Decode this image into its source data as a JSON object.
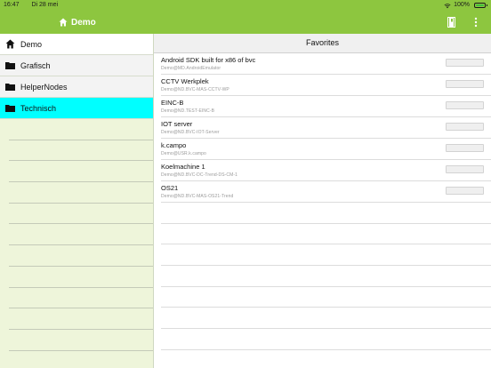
{
  "status_bar": {
    "time": "16:47",
    "date": "Di 28 mei",
    "battery": "100%",
    "battery_level": 1.0
  },
  "nav_bar": {
    "title": "Demo",
    "icons": [
      "home-icon",
      "bookmark-icon",
      "more-vertical-icon"
    ]
  },
  "sidebar": {
    "items": [
      {
        "label": "Demo",
        "icon": "home-icon"
      },
      {
        "label": "Grafisch",
        "icon": "folder-icon"
      },
      {
        "label": "HelperNodes",
        "icon": "folder-icon"
      },
      {
        "label": "Technisch",
        "icon": "folder-icon"
      }
    ],
    "selected": "Technisch"
  },
  "main": {
    "header": "Favorites",
    "favorites": [
      {
        "name": "Android SDK built for x86 of bvc",
        "path": "Demo@MD.AndroidEmulator",
        "value": ""
      },
      {
        "name": "CCTV Werkplek",
        "path": "Demo@ND.BVC-MAS-CCTV-WP",
        "value": ""
      },
      {
        "name": "EINC-B",
        "path": "Demo@ND.TEST-EINC-B",
        "value": ""
      },
      {
        "name": "IOT server",
        "path": "Demo@ND.BVC-IOT-Server",
        "value": ""
      },
      {
        "name": "k.campo",
        "path": "Demo@USR.k.campo",
        "value": ""
      },
      {
        "name": "Koelmachine 1",
        "path": "Demo@ND.BVC-DC-Trend-DS-CM-1",
        "value": ""
      },
      {
        "name": "OS21",
        "path": "Demo@ND.BVC-MAS-OS21-Trend",
        "value": ""
      }
    ]
  },
  "colors": {
    "accent": "#8dc63f",
    "selected": "#00ffff",
    "sidebar_bg": "#eef5da"
  }
}
